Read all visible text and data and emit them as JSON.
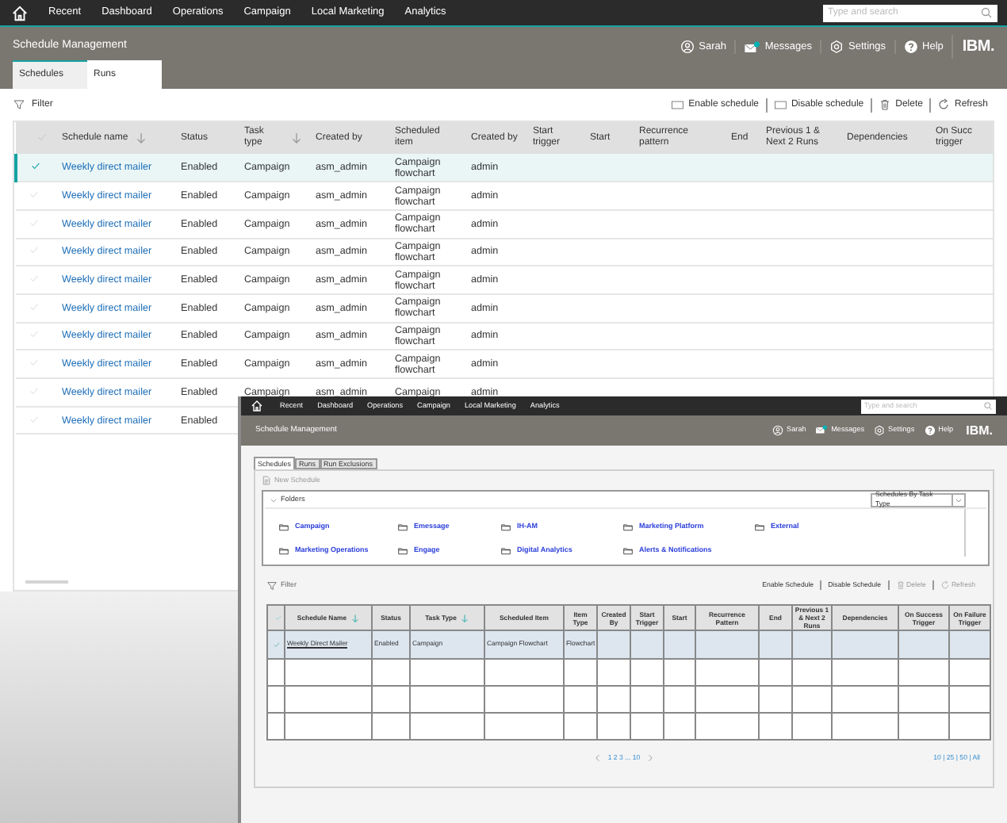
{
  "background_app": {
    "nav": {
      "menu": [
        "Recent",
        "Dashboard",
        "Operations",
        "Campaign",
        "Local Marketing",
        "Analytics"
      ],
      "search_placeholder": "Type and search"
    },
    "header": {
      "title": "Schedule Management",
      "user": "Sarah",
      "messages": "Messages",
      "settings": "Settings",
      "help": "Help",
      "logo": "IBM."
    },
    "tabs": [
      {
        "label": "Schedules",
        "selected": true
      },
      {
        "label": "Runs",
        "selected": false
      }
    ],
    "toolbar": {
      "filter": "Filter",
      "actions": [
        {
          "kind": "enable",
          "label": "Enable schedule"
        },
        {
          "kind": "disable",
          "label": "Disable schedule"
        },
        {
          "kind": "delete",
          "label": "Delete"
        },
        {
          "kind": "refresh",
          "label": "Refresh"
        }
      ]
    },
    "table": {
      "columns": [
        {
          "label": "Schedule name",
          "sortable": true
        },
        {
          "label": "Status",
          "sortable": false
        },
        {
          "label": "Task type",
          "sortable": true
        },
        {
          "label": "Created by",
          "sortable": false
        },
        {
          "label": "Scheduled item",
          "sortable": false
        },
        {
          "label": "Created by",
          "sortable": false
        },
        {
          "label": "Start trigger",
          "sortable": false
        },
        {
          "label": "Start",
          "sortable": false
        },
        {
          "label": "Recurrence pattern",
          "sortable": false
        },
        {
          "label": "End",
          "sortable": false
        },
        {
          "label": "Previous 1 & Next 2 Runs",
          "sortable": false
        },
        {
          "label": "Dependencies",
          "sortable": false
        },
        {
          "label": "On Succ trigger",
          "sortable": false
        }
      ],
      "rows": [
        {
          "selected": true,
          "cells": [
            "Weekly direct mailer",
            "Enabled",
            "Campaign",
            "asm_admin",
            "Campaign flowchart",
            "admin"
          ]
        },
        {
          "selected": false,
          "cells": [
            "Weekly direct mailer",
            "Enabled",
            "Campaign",
            "asm_admin",
            "Campaign flowchart",
            "admin"
          ]
        },
        {
          "selected": false,
          "cells": [
            "Weekly direct mailer",
            "Enabled",
            "Campaign",
            "asm_admin",
            "Campaign flowchart",
            "admin"
          ]
        },
        {
          "selected": false,
          "cells": [
            "Weekly direct mailer",
            "Enabled",
            "Campaign",
            "asm_admin",
            "Campaign flowchart",
            "admin"
          ]
        },
        {
          "selected": false,
          "cells": [
            "Weekly direct mailer",
            "Enabled",
            "Campaign",
            "asm_admin",
            "Campaign flowchart",
            "admin"
          ]
        },
        {
          "selected": false,
          "cells": [
            "Weekly direct mailer",
            "Enabled",
            "Campaign",
            "asm_admin",
            "Campaign flowchart",
            "admin"
          ]
        },
        {
          "selected": false,
          "cells": [
            "Weekly direct mailer",
            "Enabled",
            "Campaign",
            "asm_admin",
            "Campaign flowchart",
            "admin"
          ]
        },
        {
          "selected": false,
          "cells": [
            "Weekly direct mailer",
            "Enabled",
            "Campaign",
            "asm_admin",
            "Campaign flowchart",
            "admin"
          ]
        },
        {
          "selected": false,
          "cells": [
            "Weekly direct mailer",
            "Enabled",
            "Campaign",
            "asm_admin",
            "Campaign",
            "admin"
          ]
        },
        {
          "selected": false,
          "cells": [
            "Weekly direct mailer",
            "Enabled"
          ]
        }
      ]
    }
  },
  "foreground_app": {
    "nav": {
      "menu": [
        "Recent",
        "Dashboard",
        "Operations",
        "Campaign",
        "Local Marketing",
        "Analytics"
      ],
      "search_placeholder": "Type and search"
    },
    "header": {
      "title": "Schedule Management",
      "user": "Sarah",
      "messages": "Messages",
      "settings": "Settings",
      "help": "Help",
      "logo": "IBM."
    },
    "tabs": [
      {
        "label": "Schedules",
        "selected": true
      },
      {
        "label": "Runs",
        "selected": false
      },
      {
        "label": "Run Exclusions",
        "selected": false
      }
    ],
    "new_schedule": "New Schedule",
    "folders": {
      "title": "Folders",
      "expanded": true,
      "view_select": "Schedules By Task Type",
      "items": [
        "Campaign",
        "Emessage",
        "IH-AM",
        "Marketing Platform",
        "External",
        "Marketing Operations",
        "Engage",
        "Digital Analytics",
        "Alerts & Notifications"
      ]
    },
    "toolbar": {
      "filter": "Filter",
      "actions": [
        {
          "kind": "enable",
          "label": "Enable Schedule",
          "disabled": false
        },
        {
          "kind": "disable",
          "label": "Disable Schedule",
          "disabled": false
        },
        {
          "kind": "delete",
          "label": "Delete",
          "disabled": true
        },
        {
          "kind": "refresh",
          "label": "Refresh",
          "disabled": true
        }
      ]
    },
    "table": {
      "columns": [
        {
          "label": "Schedule Name",
          "sortable": true
        },
        {
          "label": "Status",
          "sortable": false
        },
        {
          "label": "Task Type",
          "sortable": true
        },
        {
          "label": "Scheduled Item",
          "sortable": false
        },
        {
          "label": "Item Type",
          "sortable": false
        },
        {
          "label": "Created By",
          "sortable": false
        },
        {
          "label": "Start Trigger",
          "sortable": false
        },
        {
          "label": "Start",
          "sortable": false
        },
        {
          "label": "Recurrence Pattern",
          "sortable": false
        },
        {
          "label": "End",
          "sortable": false
        },
        {
          "label": "Previous 1 & Next 2 Runs",
          "sortable": false
        },
        {
          "label": "Dependencies",
          "sortable": false
        },
        {
          "label": "On Success Trigger",
          "sortable": false
        },
        {
          "label": "On Failure Trigger",
          "sortable": false
        }
      ],
      "rows": [
        {
          "selected": true,
          "cells": [
            "Weekly Direct Mailer",
            "Enabled",
            "Campaign",
            "Campaign Flowchart",
            "Flowchart"
          ]
        }
      ]
    },
    "pagination": {
      "pages": "1 2 3 ... 10",
      "page_sizes": "10 | 25 | 50 | All"
    }
  }
}
